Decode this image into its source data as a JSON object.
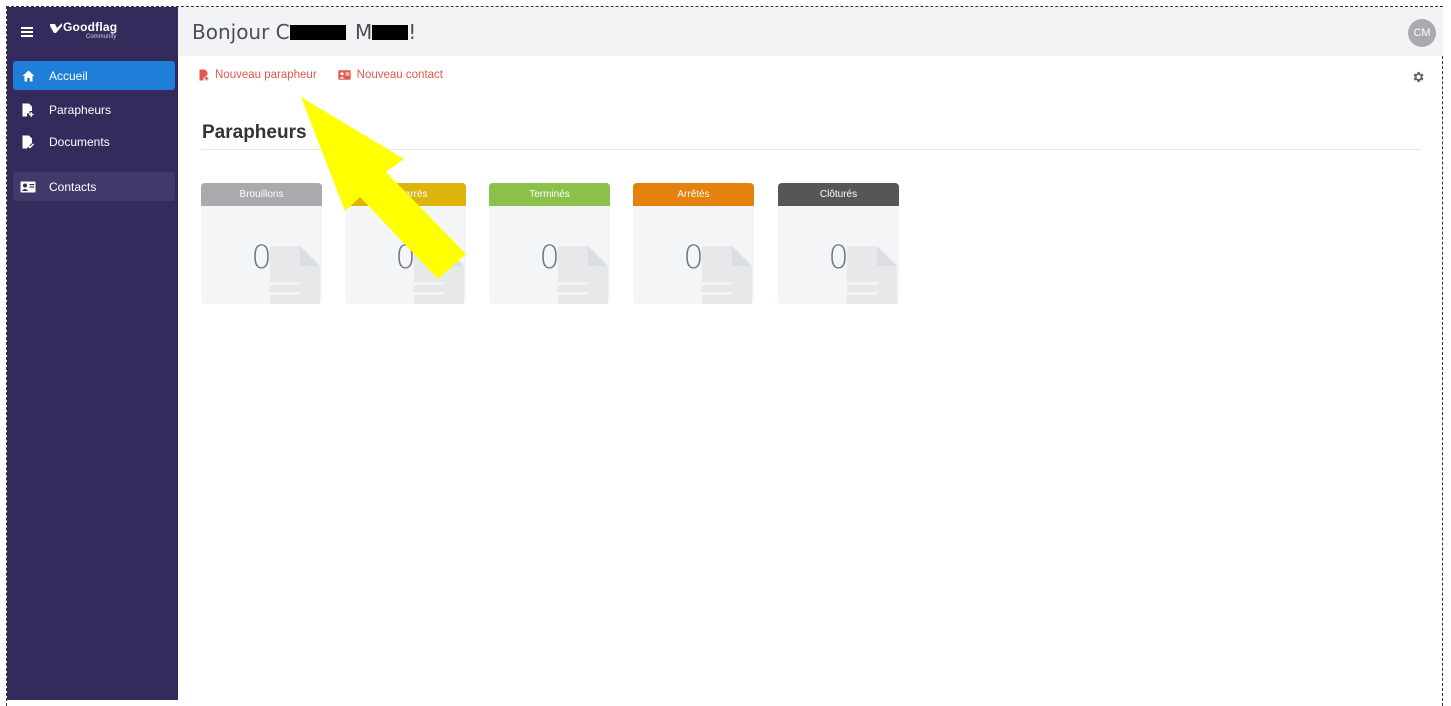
{
  "app": {
    "logo_text": "Goodflag",
    "logo_subtext": "Community"
  },
  "sidebar": {
    "items": [
      {
        "label": "Accueil",
        "icon": "home-icon",
        "active": true
      },
      {
        "label": "Parapheurs",
        "icon": "document-add-icon"
      },
      {
        "label": "Documents",
        "icon": "document-check-icon"
      },
      {
        "label": "Contacts",
        "icon": "contact-card-icon",
        "hover": true
      }
    ]
  },
  "header": {
    "greeting_prefix": "Bonjour C",
    "greeting_middle": "M",
    "greeting_suffix": "!",
    "avatar_initials": "CM"
  },
  "actions": {
    "new_parapheur": "Nouveau parapheur",
    "new_contact": "Nouveau contact"
  },
  "main": {
    "title": "Parapheurs",
    "cards": [
      {
        "label": "Brouillons",
        "count": "0",
        "color": "#a9aaad"
      },
      {
        "label": "Démarrés",
        "count": "0",
        "color": "#dcb40a"
      },
      {
        "label": "Terminés",
        "count": "0",
        "color": "#8bc04a"
      },
      {
        "label": "Arrêtés",
        "count": "0",
        "color": "#e5810d"
      },
      {
        "label": "Clôturés",
        "count": "0",
        "color": "#565656"
      }
    ]
  },
  "colors": {
    "sidebar_bg": "#352a5c",
    "active_item": "#1e7ed8",
    "accent_red": "#e0594f",
    "annotation_arrow": "#ffff00"
  }
}
